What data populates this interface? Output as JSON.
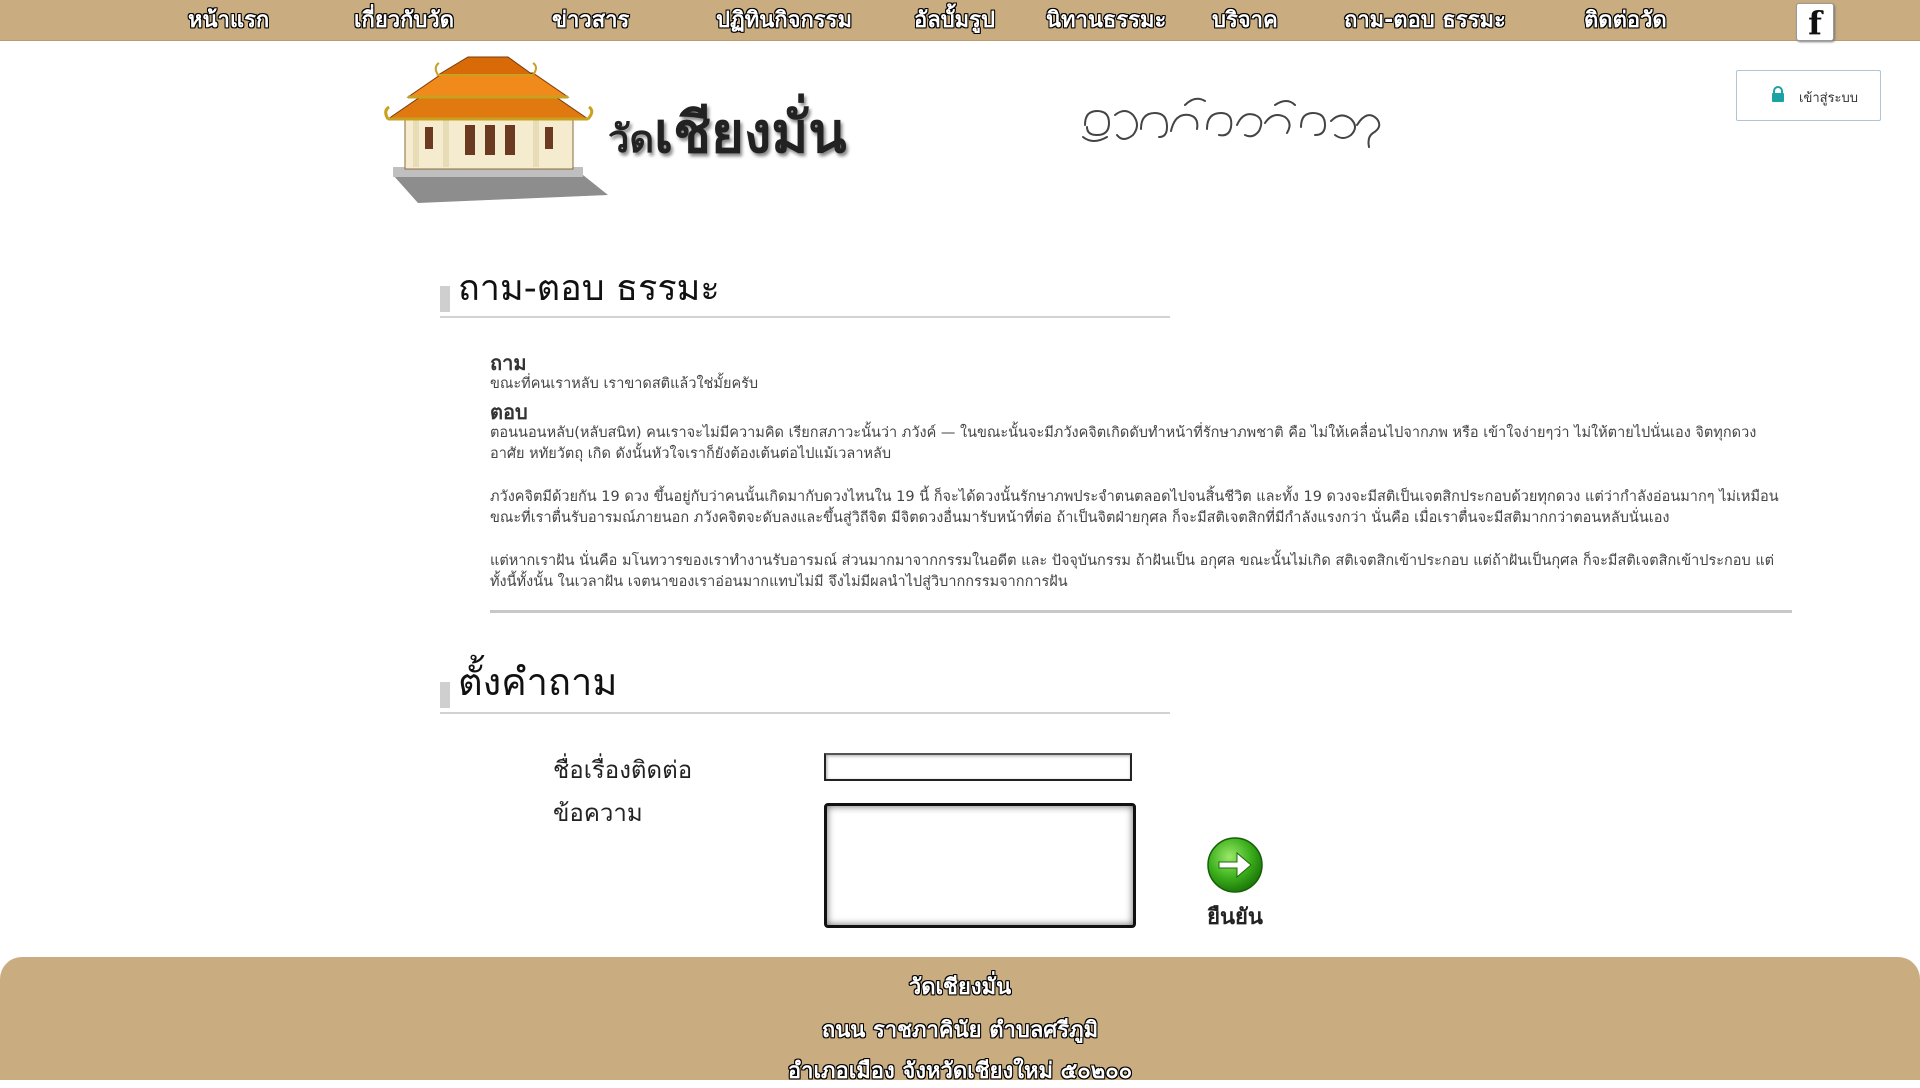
{
  "nav": {
    "items": [
      {
        "label": "หน้าแรก"
      },
      {
        "label": "เกี่ยวกับวัด"
      },
      {
        "label": "ข่าวสาร"
      },
      {
        "label": "ปฏิทินกิจกรรม"
      },
      {
        "label": "อัลบั้มรูป"
      },
      {
        "label": "นิทานธรรมะ"
      },
      {
        "label": "บริจาค"
      },
      {
        "label": "ถาม-ตอบ ธรรมะ"
      },
      {
        "label": "ติดต่อวัด"
      }
    ],
    "facebook_icon": "facebook-icon",
    "facebook_glyph": "f"
  },
  "header": {
    "title_prefix": "วัด",
    "title_main": "เชียงมั่น",
    "login_label": "เข้าสู่ระบบ",
    "login_icon": "lock-icon"
  },
  "qa_section": {
    "title": "ถาม-ตอบ ธรรมะ",
    "question_label": "ถาม",
    "question": "ขณะที่คนเราหลับ เราขาดสติแล้วใช่มั้ยครับ",
    "answer_label": "ตอบ",
    "answer_paragraphs": [
      "ตอนนอนหลับ(หลับสนิท) คนเราจะไม่มีความคิด เรียกสภาวะนั้นว่า ภวังค์ — ในขณะนั้นจะมีภวังคจิตเกิดดับทำหน้าที่รักษาภพชาติ คือ ไม่ให้เคลื่อนไปจากภพ หรือ เข้าใจง่ายๆว่า ไม่ให้ตายไปนั่นเอง จิตทุกดวงอาศัย หทัยวัตถุ เกิด ดังนั้นหัวใจเราก็ยังต้องเต้นต่อไปแม้เวลาหลับ",
      "ภวังคจิตมีด้วยกัน 19 ดวง ขึ้นอยู่กับว่าคนนั้นเกิดมากับดวงไหนใน 19 นี้ ก็จะได้ดวงนั้นรักษาภพประจำตนตลอดไปจนสิ้นชีวิต และทั้ง 19 ดวงจะมีสติเป็นเจตสิกประกอบด้วยทุกดวง แต่ว่ากำลังอ่อนมากๆ ไม่เหมือนขณะที่เราตื่นรับอารมณ์ภายนอก ภวังคจิตจะดับลงและขึ้นสู่วิถีจิต มีจิตดวงอื่นมารับหน้าที่ต่อ ถ้าเป็นจิตฝ่ายกุศล ก็จะมีสติเจตสิกที่มีกำลังแรงกว่า นั่นคือ เมื่อเราตื่นจะมีสติมากกว่าตอนหลับนั่นเอง",
      "แต่หากเราฝัน นั่นคือ มโนทวารของเราทำงานรับอารมณ์ ส่วนมากมาจากกรรมในอดีต และ ปัจจุบันกรรม ถ้าฝันเป็น อกุศล ขณะนั้นไม่เกิด สติเจตสิกเข้าประกอบ แต่ถ้าฝันเป็นกุศล ก็จะมีสติเจตสิกเข้าประกอบ แต่ทั้งนี้ทั้งนั้น ในเวลาฝัน เจตนาของเราอ่อนมากแทบไม่มี จึงไม่มีผลนำไปสู่วิบากกรรมจากการฝัน"
    ]
  },
  "ask_section": {
    "title": "ตั้งคำถาม",
    "subject_label": "ชื่อเรื่องติดต่อ",
    "subject_value": "",
    "message_label": "ข้อความ",
    "message_value": "",
    "submit_label": "ยืนยัน",
    "submit_icon": "arrow-right-circle-icon"
  },
  "footer": {
    "name": "วัดเชียงมั่น",
    "address_line1": "ถนน ราชภาคินัย ตำบลศรีภูมิ",
    "address_line2": "อำเภอเมือง จังหวัดเชียงใหม่ ๕๐๒๐๐"
  },
  "colors": {
    "nav_bg": "#c9ad80",
    "footer_bg": "#c9ad80",
    "submit_green": "#3cb01c"
  }
}
